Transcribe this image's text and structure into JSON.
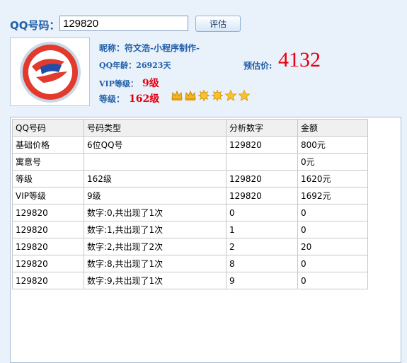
{
  "header": {
    "qq_label": "QQ号码：",
    "qq_value": "129820",
    "eval_button": "评估"
  },
  "info": {
    "nickname_label": "昵称：",
    "nickname_value": "符文浩-小程序制作-",
    "age_label": "QQ年龄：",
    "age_value": "26923天",
    "vip_label": "VIP等级：",
    "vip_value": "9级",
    "level_label": "等级：",
    "level_value": "162级",
    "price_label": "预估价:",
    "price_value": "4132"
  },
  "level_icons": [
    "crown-icon",
    "crown-icon",
    "sun-icon",
    "sun-icon",
    "star-icon",
    "star-icon"
  ],
  "colors": {
    "accent_blue": "#1f5fa8",
    "value_red": "#e60012",
    "crown": "#f3b41c"
  },
  "table": {
    "headers": [
      "QQ号码",
      "号码类型",
      "分析数字",
      "金额"
    ],
    "rows": [
      [
        "基础价格",
        "6位QQ号",
        "129820",
        "800元"
      ],
      [
        "寓意号",
        "",
        "",
        "0元"
      ],
      [
        "等级",
        "162级",
        "129820",
        "1620元"
      ],
      [
        "VIP等级",
        "9级",
        "129820",
        "1692元"
      ],
      [
        "129820",
        "数字:0,共出现了1次",
        "0",
        "0"
      ],
      [
        "129820",
        "数字:1,共出现了1次",
        "1",
        "0"
      ],
      [
        "129820",
        "数字:2,共出现了2次",
        "2",
        "20"
      ],
      [
        "129820",
        "数字:8,共出现了1次",
        "8",
        "0"
      ],
      [
        "129820",
        "数字:9,共出现了1次",
        "9",
        "0"
      ]
    ]
  }
}
